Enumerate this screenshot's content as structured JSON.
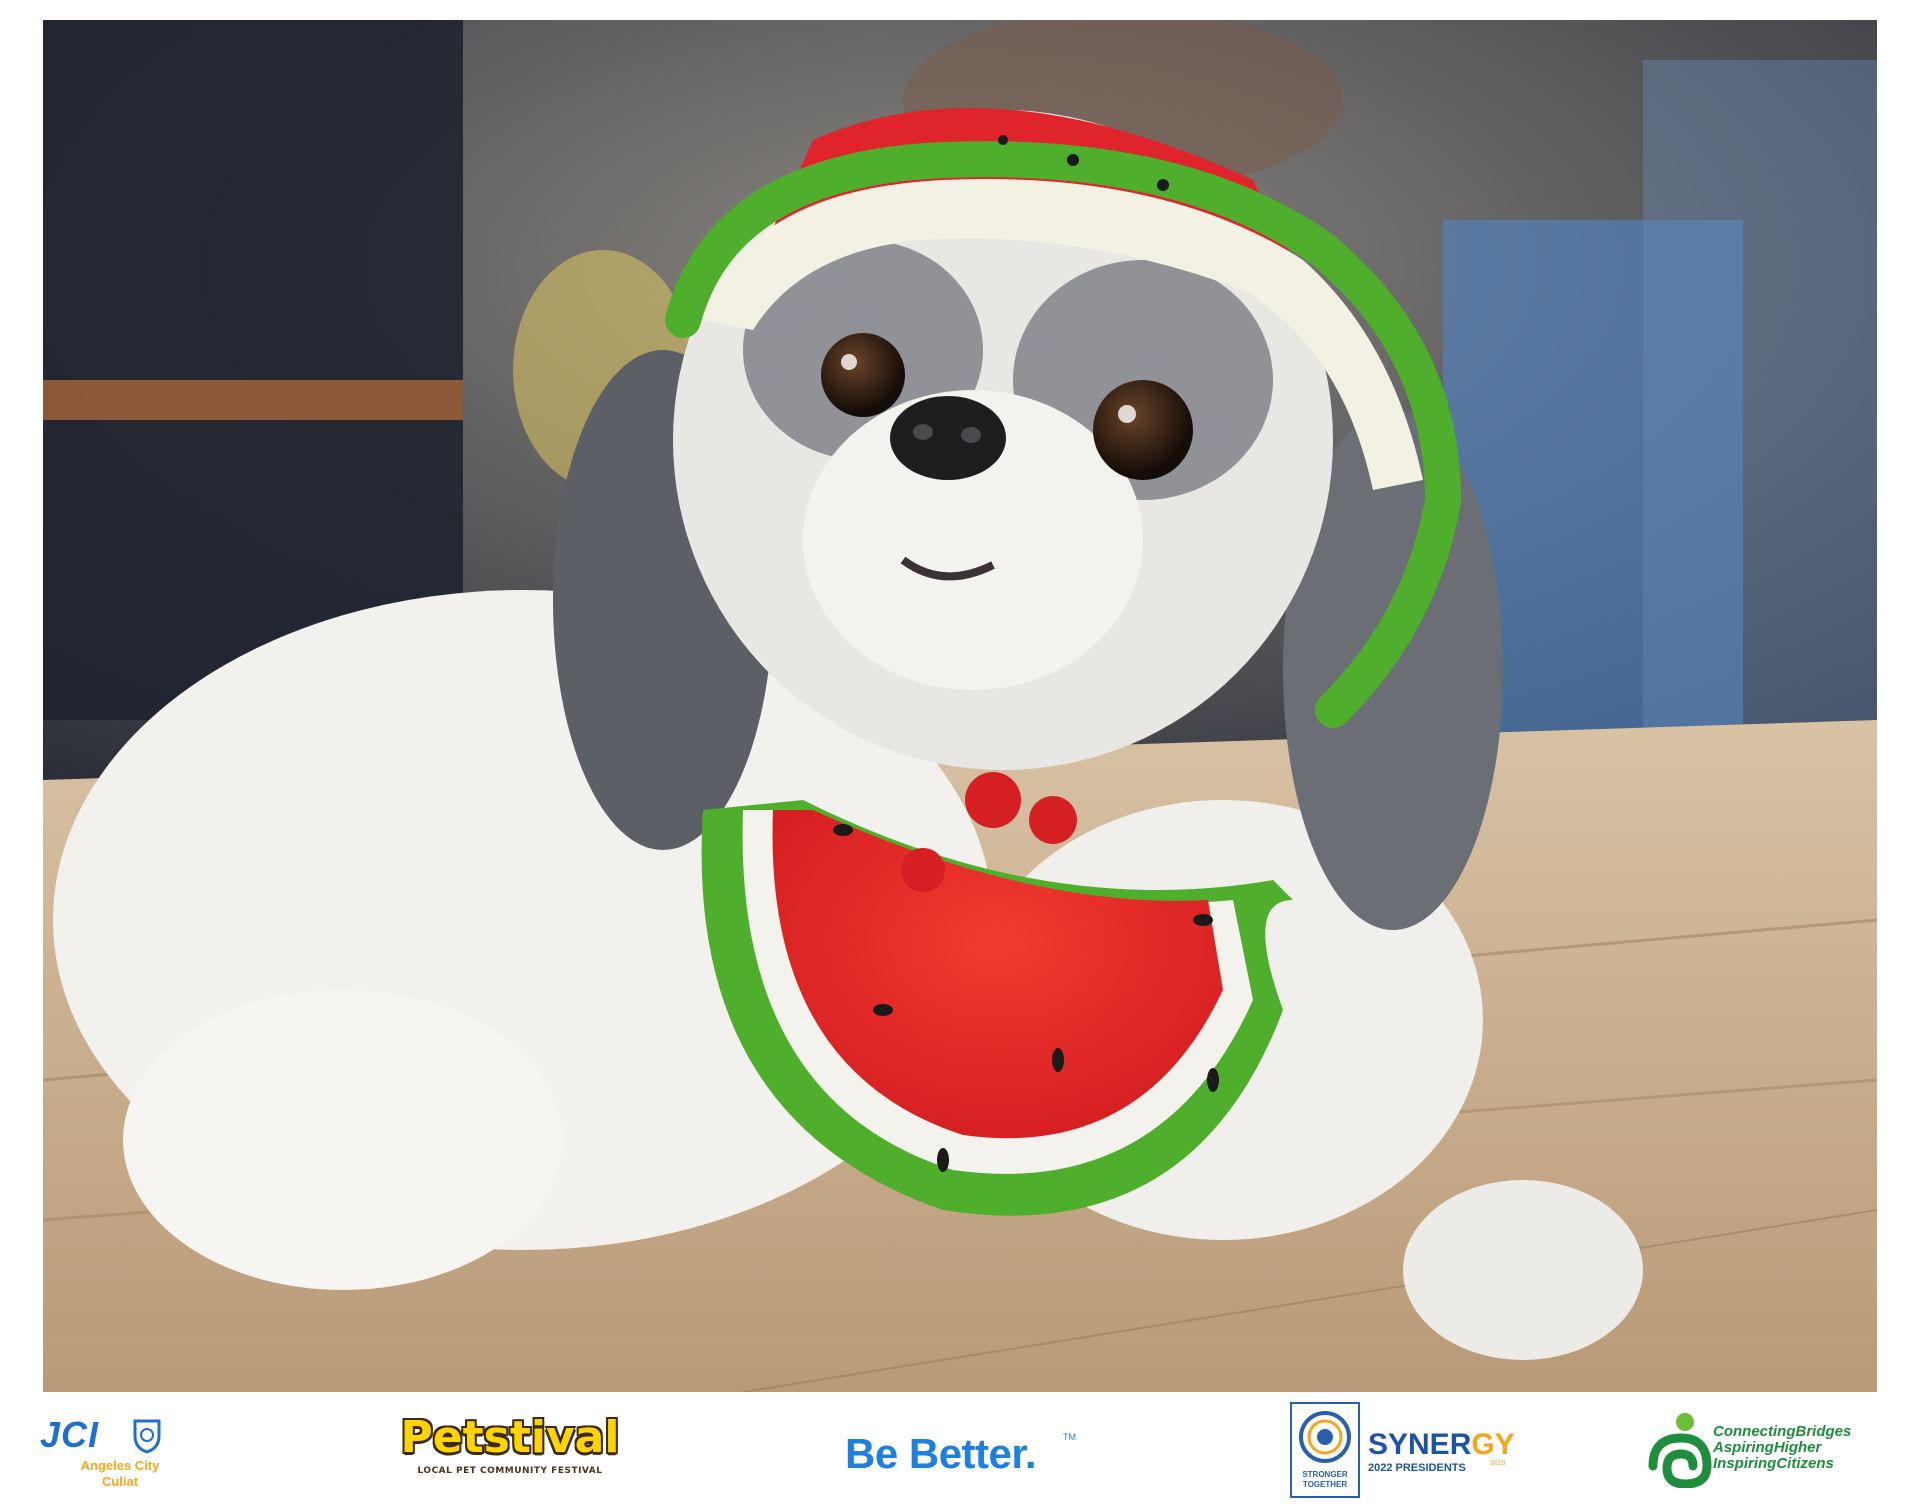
{
  "photo": {
    "subject": "dog-in-watermelon-crochet-hat-and-bib"
  },
  "logos": {
    "jci": {
      "word": "JCI",
      "line1": "Angeles City",
      "line2": "Culiat"
    },
    "petstival": {
      "word": "Petstival",
      "tagline": "LOCAL PET COMMUNITY FESTIVAL"
    },
    "be_better": {
      "word": "Be Better.",
      "tm": "TM"
    },
    "stronger_together": {
      "line1": "STRONGER",
      "line2": "TOGETHER"
    },
    "synergy": {
      "word_a": "SYNER",
      "word_b": "GY",
      "sub": "2022 PRESIDENTS",
      "year": "2019"
    },
    "cbi": {
      "line1": "ConnectingBridges",
      "line2": "AspiringHigher",
      "line3": "InspiringCitizens"
    }
  },
  "colors": {
    "jci_blue": "#1e6fd1",
    "jci_gold": "#f4a61d",
    "petstival_yellow": "#ffd400",
    "be_better_blue": "#1e7fe0",
    "synergy_blue": "#1d54a8",
    "cbi_green": "#1f8c3e",
    "watermelon_red": "#e8262a",
    "watermelon_green": "#4fae2c"
  }
}
